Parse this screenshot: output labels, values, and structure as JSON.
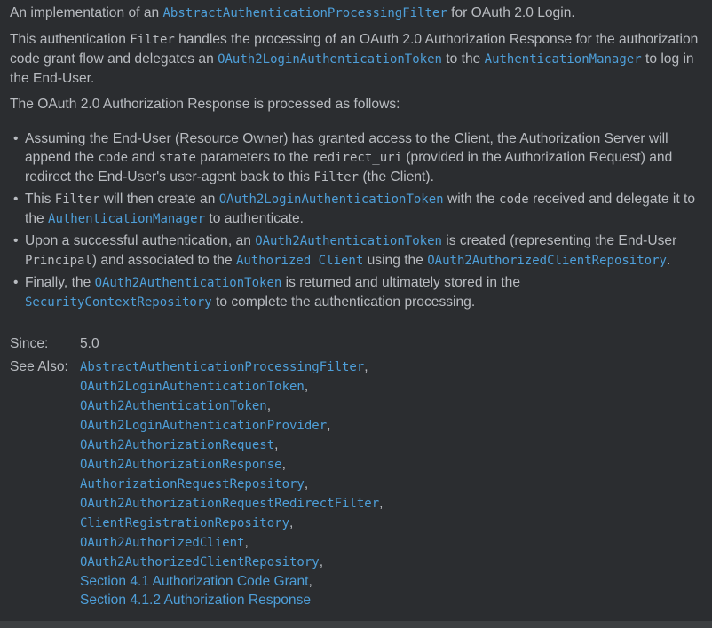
{
  "intro": {
    "t1": "An implementation of an ",
    "c1": "AbstractAuthenticationProcessingFilter",
    "t2": " for OAuth 2.0 Login."
  },
  "para2": {
    "t1": "This authentication ",
    "c1": "Filter",
    "t2": " handles the processing of an OAuth 2.0 Authorization Response for the authorization code grant flow and delegates an ",
    "l1": "OAuth2LoginAuthenticationToken",
    "t3": " to the ",
    "l2": "AuthenticationManager",
    "t4": " to log in the End-User."
  },
  "para3": "The OAuth 2.0 Authorization Response is processed as follows:",
  "bullet_char": "•",
  "bullets": {
    "b1": {
      "t1": "Assuming the End-User (Resource Owner) has granted access to the Client, the Authorization Server will append the ",
      "c1": "code",
      "t2": " and ",
      "c2": "state",
      "t3": " parameters to the ",
      "c3": "redirect_uri",
      "t4": " (provided in the Authorization Request) and redirect the End-User's user-agent back to this ",
      "c4": "Filter",
      "t5": " (the Client)."
    },
    "b2": {
      "t1": "This ",
      "c1": "Filter",
      "t2": " will then create an ",
      "l1": "OAuth2LoginAuthenticationToken",
      "t3": " with the ",
      "c2": "code",
      "t4": " received and delegate it to the ",
      "l2": "AuthenticationManager",
      "t5": " to authenticate."
    },
    "b3": {
      "t1": "Upon a successful authentication, an ",
      "l1": "OAuth2AuthenticationToken",
      "t2": " is created (representing the End-User ",
      "c1": "Principal",
      "t3": ") and associated to the ",
      "l2": "Authorized Client",
      "t4": " using the ",
      "l3": "OAuth2AuthorizedClientRepository",
      "t5": "."
    },
    "b4": {
      "t1": "Finally, the ",
      "l1": "OAuth2AuthenticationToken",
      "t2": " is returned and ultimately stored in the ",
      "l2": "SecurityContextRepository",
      "t3": " to complete the authentication processing."
    }
  },
  "since": {
    "label": "Since:",
    "value": "5.0"
  },
  "see_also": {
    "label": "See Also:",
    "items": [
      "AbstractAuthenticationProcessingFilter",
      "OAuth2LoginAuthenticationToken",
      "OAuth2AuthenticationToken",
      "OAuth2LoginAuthenticationProvider",
      "OAuth2AuthorizationRequest",
      "OAuth2AuthorizationResponse",
      "AuthorizationRequestRepository",
      "OAuth2AuthorizationRequestRedirectFilter",
      "ClientRegistrationRepository",
      "OAuth2AuthorizedClient",
      "OAuth2AuthorizedClientRepository",
      "Section 4.1 Authorization Code Grant",
      "Section 4.1.2 Authorization Response"
    ],
    "comma": ","
  }
}
